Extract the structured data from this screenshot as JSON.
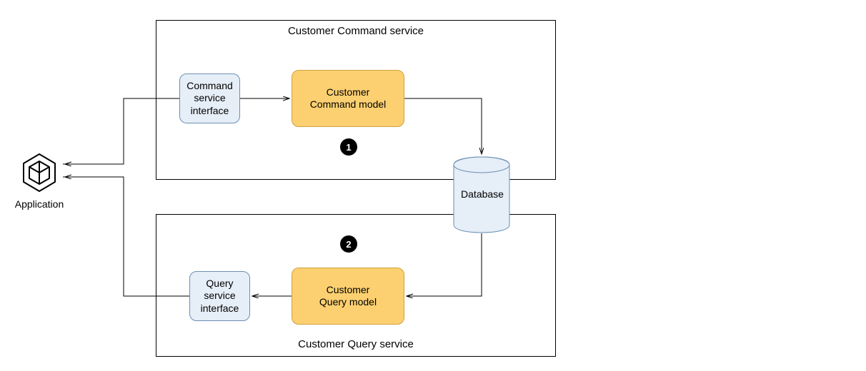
{
  "application": {
    "label": "Application"
  },
  "groups": {
    "command": {
      "title": "Customer Command service"
    },
    "query": {
      "title": "Customer Query service"
    }
  },
  "nodes": {
    "commandInterface": "Command\nservice\ninterface",
    "commandModel": "Customer\nCommand model",
    "queryInterface": "Query\nservice\ninterface",
    "queryModel": "Customer\nQuery model",
    "database": "Database"
  },
  "badges": {
    "one": "1",
    "two": "2"
  }
}
